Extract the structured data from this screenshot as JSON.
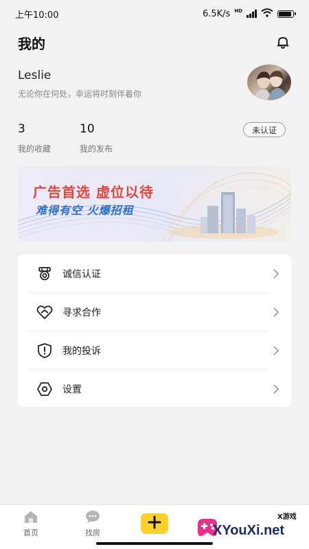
{
  "status_bar": {
    "time": "上午10:00",
    "network_speed": "6.5K/s",
    "network_label": "HD",
    "battery_level": 0.9
  },
  "header": {
    "title": "我的",
    "bell_icon": "bell-icon"
  },
  "profile": {
    "username": "Leslie",
    "motto": "无论你在何处，幸运将时刻伴着你"
  },
  "stats": [
    {
      "value": "3",
      "label": "我的收藏"
    },
    {
      "value": "10",
      "label": "我的发布"
    }
  ],
  "verify_button": "未认证",
  "banner": {
    "title": "广告首选  虚位以待",
    "subtitle": "难得有空  火爆招租"
  },
  "menu": [
    {
      "label": "诚信认证",
      "icon": "badge-icon"
    },
    {
      "label": "寻求合作",
      "icon": "handshake-icon"
    },
    {
      "label": "我的投诉",
      "icon": "shield-alert-icon"
    },
    {
      "label": "设置",
      "icon": "gear-icon"
    }
  ],
  "tabbar": {
    "tabs": [
      {
        "label": "首页",
        "icon": "home-icon"
      },
      {
        "label": "找房",
        "icon": "chat-icon"
      }
    ],
    "publish_icon": "plus-icon"
  },
  "watermark": {
    "text": "XYouXi.net",
    "small": "X游戏"
  },
  "colors": {
    "accent": "#fcd22a",
    "banner_title": "#e2453a",
    "banner_subtitle": "#2f6fc9"
  }
}
